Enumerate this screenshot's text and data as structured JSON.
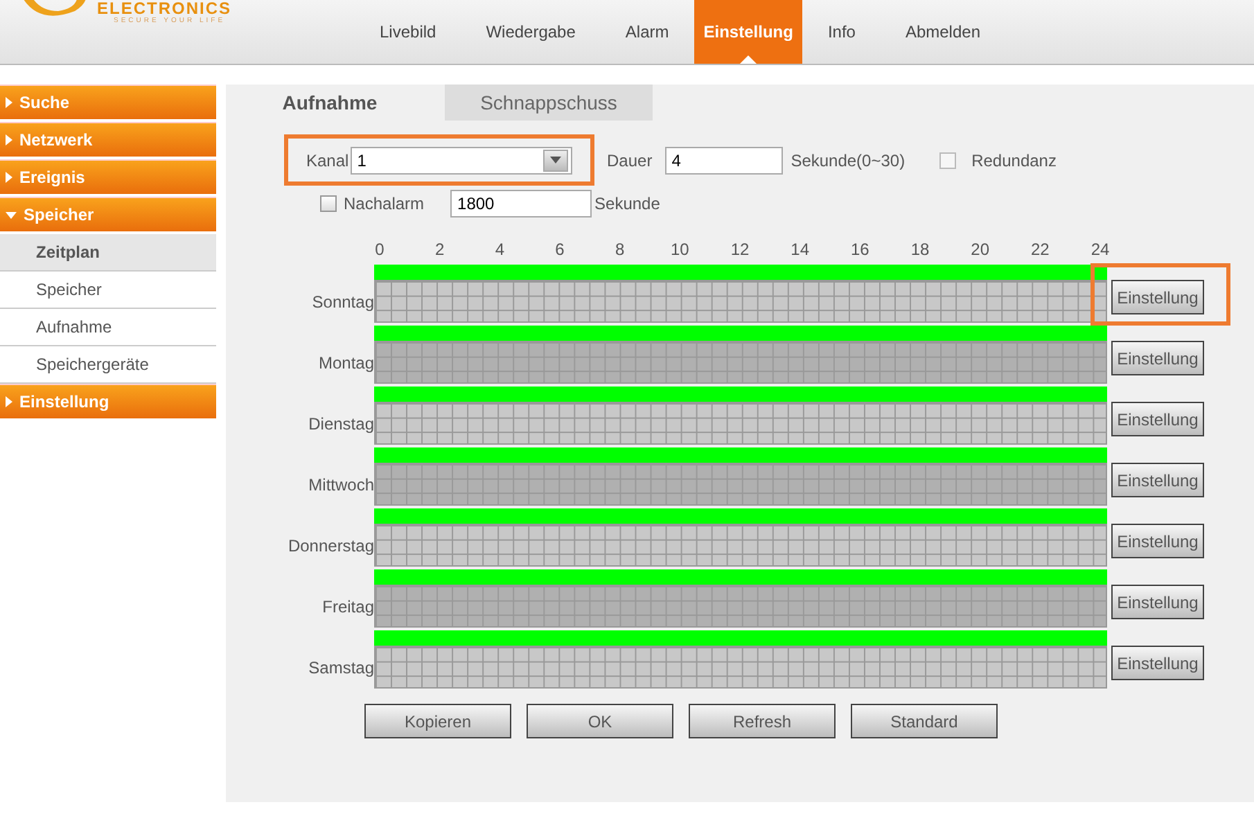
{
  "header": {
    "logo_text": "ELECTRONICS",
    "tagline": "SECURE YOUR LIFE",
    "nav": [
      {
        "label": "Livebild",
        "selected": false
      },
      {
        "label": "Wiedergabe",
        "selected": false
      },
      {
        "label": "Alarm",
        "selected": false
      },
      {
        "label": "Einstellung",
        "selected": true
      },
      {
        "label": "Info",
        "selected": false
      },
      {
        "label": "Abmelden",
        "selected": false
      }
    ]
  },
  "sidebar": {
    "items": [
      {
        "label": "Suche",
        "expanded": false
      },
      {
        "label": "Netzwerk",
        "expanded": false
      },
      {
        "label": "Ereignis",
        "expanded": false
      },
      {
        "label": "Speicher",
        "expanded": true,
        "children": [
          {
            "label": "Zeitplan",
            "selected": true
          },
          {
            "label": "Speicher",
            "selected": false
          },
          {
            "label": "Aufnahme",
            "selected": false
          },
          {
            "label": "Speichergeräte",
            "selected": false
          }
        ]
      },
      {
        "label": "Einstellung",
        "expanded": false
      }
    ]
  },
  "tabs": [
    {
      "label": "Aufnahme",
      "selected": true
    },
    {
      "label": "Schnappschuss",
      "selected": false
    }
  ],
  "form": {
    "channel": {
      "label": "Kanal",
      "value": "1",
      "highlighted": true
    },
    "duration": {
      "label": "Dauer",
      "value": "4",
      "unit": "Sekunde(0~30)"
    },
    "redundancy": {
      "label": "Redundanz",
      "checked": false
    },
    "post_alarm": {
      "label": "Nachalarm",
      "checked": false,
      "value": "1800",
      "unit": "Sekunde"
    }
  },
  "schedule": {
    "hours": [
      "0",
      "2",
      "4",
      "6",
      "8",
      "10",
      "12",
      "14",
      "16",
      "18",
      "20",
      "22",
      "24"
    ],
    "days": [
      {
        "label": "Sonntag",
        "recording": true,
        "button": "Einstellung",
        "highlighted": true
      },
      {
        "label": "Montag",
        "recording": true,
        "button": "Einstellung",
        "highlighted": false
      },
      {
        "label": "Dienstag",
        "recording": true,
        "button": "Einstellung",
        "highlighted": false
      },
      {
        "label": "Mittwoch",
        "recording": true,
        "button": "Einstellung",
        "highlighted": false
      },
      {
        "label": "Donnerstag",
        "recording": true,
        "button": "Einstellung",
        "highlighted": false
      },
      {
        "label": "Freitag",
        "recording": true,
        "button": "Einstellung",
        "highlighted": false
      },
      {
        "label": "Samstag",
        "recording": true,
        "button": "Einstellung",
        "highlighted": false
      }
    ]
  },
  "buttons": [
    "Kopieren",
    "OK",
    "Refresh",
    "Standard"
  ]
}
